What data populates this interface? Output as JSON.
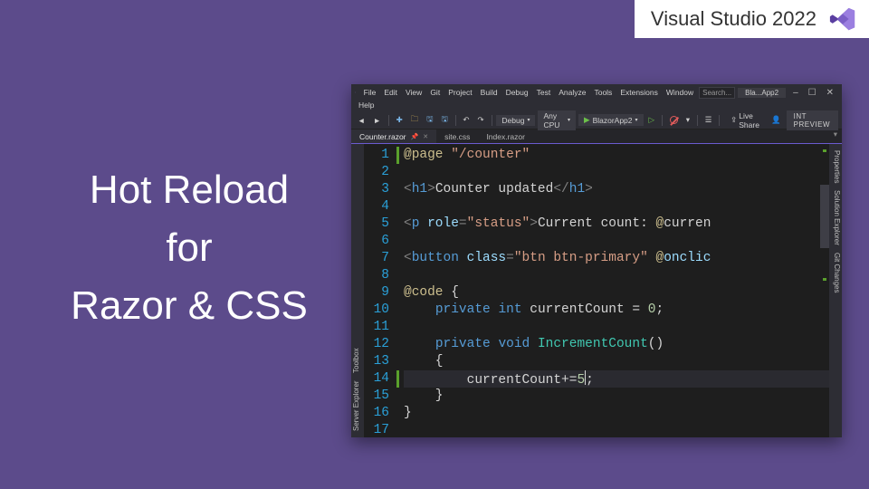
{
  "badge": {
    "label": "Visual Studio 2022"
  },
  "headline": {
    "line1": "Hot Reload",
    "line2": "for",
    "line3": "Razor & CSS"
  },
  "menubar": {
    "items": [
      "File",
      "Edit",
      "View",
      "Git",
      "Project",
      "Build",
      "Debug",
      "Test",
      "Analyze",
      "Tools",
      "Extensions",
      "Window"
    ],
    "items2": [
      "Help"
    ],
    "search_placeholder": "Search...",
    "solution_crumb": "Bla...App2",
    "win_min": "–",
    "win_max": "☐",
    "win_close": "✕"
  },
  "toolbar": {
    "config": "Debug",
    "platform": "Any CPU",
    "run_target": "BlazorApp2",
    "liveshare": "Live Share",
    "preview": "INT PREVIEW"
  },
  "doctabs": {
    "tabs": [
      {
        "label": "Counter.razor",
        "active": true
      },
      {
        "label": "site.css",
        "active": false
      },
      {
        "label": "Index.razor",
        "active": false
      }
    ]
  },
  "sidetabs": {
    "left": [
      "Server Explorer",
      "Toolbox"
    ],
    "right": [
      "Properties",
      "Solution Explorer",
      "Git Changes"
    ]
  },
  "editor": {
    "change_markers": [
      1,
      14
    ],
    "highlighted_line": 14,
    "lines": [
      {
        "n": 1,
        "tokens": [
          [
            "dir",
            "@page"
          ],
          [
            "txt",
            " "
          ],
          [
            "str",
            "\"/counter\""
          ]
        ]
      },
      {
        "n": 2,
        "tokens": []
      },
      {
        "n": 3,
        "tokens": [
          [
            "punc",
            "<"
          ],
          [
            "tag",
            "h1"
          ],
          [
            "punc",
            ">"
          ],
          [
            "txt",
            "Counter updated"
          ],
          [
            "punc",
            "</"
          ],
          [
            "tag",
            "h1"
          ],
          [
            "punc",
            ">"
          ]
        ]
      },
      {
        "n": 4,
        "tokens": []
      },
      {
        "n": 5,
        "tokens": [
          [
            "punc",
            "<"
          ],
          [
            "tag",
            "p"
          ],
          [
            "txt",
            " "
          ],
          [
            "attr",
            "role"
          ],
          [
            "punc",
            "="
          ],
          [
            "str",
            "\"status\""
          ],
          [
            "punc",
            ">"
          ],
          [
            "txt",
            "Current count: "
          ],
          [
            "razor",
            "@"
          ],
          [
            "name",
            "curren"
          ]
        ]
      },
      {
        "n": 6,
        "tokens": []
      },
      {
        "n": 7,
        "tokens": [
          [
            "punc",
            "<"
          ],
          [
            "tag",
            "button"
          ],
          [
            "txt",
            " "
          ],
          [
            "attr",
            "class"
          ],
          [
            "punc",
            "="
          ],
          [
            "str",
            "\"btn btn-primary\""
          ],
          [
            "txt",
            " "
          ],
          [
            "razor",
            "@"
          ],
          [
            "csattr",
            "onclic"
          ]
        ]
      },
      {
        "n": 8,
        "tokens": []
      },
      {
        "n": 9,
        "tokens": [
          [
            "razor",
            "@code"
          ],
          [
            "code",
            " {"
          ]
        ]
      },
      {
        "n": 10,
        "tokens": [
          [
            "code",
            "    "
          ],
          [
            "kw",
            "private"
          ],
          [
            "code",
            " "
          ],
          [
            "kw",
            "int"
          ],
          [
            "code",
            " "
          ],
          [
            "id",
            "currentCount"
          ],
          [
            "code",
            " = "
          ],
          [
            "num",
            "0"
          ],
          [
            "code",
            ";"
          ]
        ]
      },
      {
        "n": 11,
        "tokens": []
      },
      {
        "n": 12,
        "tokens": [
          [
            "code",
            "    "
          ],
          [
            "kw",
            "private"
          ],
          [
            "code",
            " "
          ],
          [
            "kw",
            "void"
          ],
          [
            "code",
            " "
          ],
          [
            "type",
            "IncrementCount"
          ],
          [
            "code",
            "()"
          ]
        ]
      },
      {
        "n": 13,
        "tokens": [
          [
            "code",
            "    {"
          ]
        ]
      },
      {
        "n": 14,
        "tokens": [
          [
            "code",
            "        "
          ],
          [
            "id",
            "currentCount"
          ],
          [
            "code",
            "+="
          ],
          [
            "num",
            "5"
          ],
          [
            "caret",
            ""
          ],
          [
            "code",
            ";"
          ]
        ]
      },
      {
        "n": 15,
        "tokens": [
          [
            "code",
            "    }"
          ]
        ]
      },
      {
        "n": 16,
        "tokens": [
          [
            "code",
            "}"
          ]
        ]
      },
      {
        "n": 17,
        "tokens": []
      }
    ]
  }
}
